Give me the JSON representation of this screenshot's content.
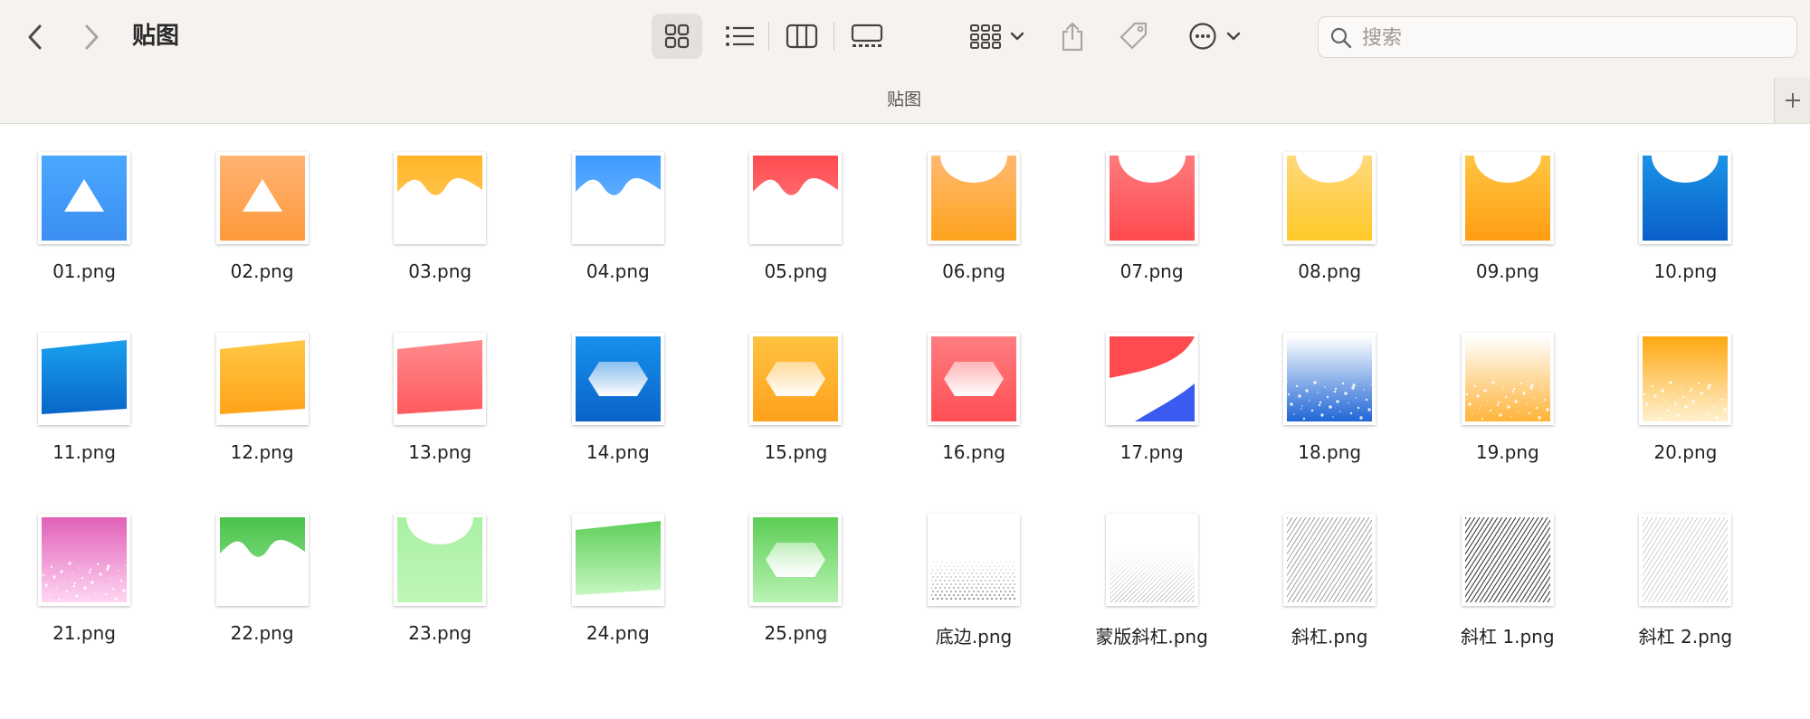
{
  "window": {
    "title": "贴图",
    "tab_title": "贴图"
  },
  "toolbar": {
    "back_icon": "chevron-left-icon",
    "forward_icon": "chevron-right-icon",
    "view_modes": [
      "icon-view",
      "list-view",
      "column-view",
      "gallery-view"
    ],
    "active_view": "icon-view"
  },
  "search": {
    "placeholder": "搜索",
    "value": ""
  },
  "files": [
    {
      "name": "01.png",
      "art": "tri",
      "c1": "#4aa8ff",
      "c2": "#3b8ef0"
    },
    {
      "name": "02.png",
      "art": "tri",
      "c1": "#ffb374",
      "c2": "#ff9a3c"
    },
    {
      "name": "03.png",
      "art": "wave",
      "c1": "#ffb428",
      "c2": "#ffd26a"
    },
    {
      "name": "04.png",
      "art": "wave",
      "c1": "#3d9bff",
      "c2": "#7fbeff"
    },
    {
      "name": "05.png",
      "art": "wave",
      "c1": "#ff4a4f",
      "c2": "#ff8a8c"
    },
    {
      "name": "06.png",
      "art": "arc",
      "c1": "#ffb870",
      "c2": "#ffa41f"
    },
    {
      "name": "07.png",
      "art": "arc",
      "c1": "#ff7a7c",
      "c2": "#ff4b50"
    },
    {
      "name": "08.png",
      "art": "arc",
      "c1": "#ffd87d",
      "c2": "#ffc928"
    },
    {
      "name": "09.png",
      "art": "arc",
      "c1": "#ffc542",
      "c2": "#ff9e14"
    },
    {
      "name": "10.png",
      "art": "arc",
      "c1": "#1a94e6",
      "c2": "#0a5fc9"
    },
    {
      "name": "11.png",
      "art": "slant",
      "c1": "#1aa0ee",
      "c2": "#0866c8"
    },
    {
      "name": "12.png",
      "art": "slant",
      "c1": "#ffc845",
      "c2": "#ffa31a"
    },
    {
      "name": "13.png",
      "art": "slant",
      "c1": "#ff8a8c",
      "c2": "#ff5a5e"
    },
    {
      "name": "14.png",
      "art": "hex",
      "c1": "#1791ee",
      "c2": "#0a63c6"
    },
    {
      "name": "15.png",
      "art": "hex",
      "c1": "#ffc341",
      "c2": "#ffa11c"
    },
    {
      "name": "16.png",
      "art": "hex",
      "c1": "#ff7d80",
      "c2": "#ff4f55"
    },
    {
      "name": "17.png",
      "art": "pepsi",
      "c1": "#ff4b50",
      "c2": "#3b5bf0"
    },
    {
      "name": "18.png",
      "art": "sparkle",
      "c1": "#ffffff",
      "c2": "#1f66d6"
    },
    {
      "name": "19.png",
      "art": "sparkle",
      "c1": "#ffffff",
      "c2": "#ffb43a"
    },
    {
      "name": "20.png",
      "art": "sparkle",
      "c1": "#ffa812",
      "c2": "#fff1cf"
    },
    {
      "name": "21.png",
      "art": "sparkle",
      "c1": "#e060b8",
      "c2": "#ffd6f2"
    },
    {
      "name": "22.png",
      "art": "wave",
      "c1": "#49c24a",
      "c2": "#9de89a"
    },
    {
      "name": "23.png",
      "art": "arc",
      "c1": "#a9f0a4",
      "c2": "#bff7b7"
    },
    {
      "name": "24.png",
      "art": "slant",
      "c1": "#5fd05a",
      "c2": "#c6f7c1"
    },
    {
      "name": "25.png",
      "art": "hex",
      "c1": "#5ccd54",
      "c2": "#b9f3b3"
    },
    {
      "name": "底边.png",
      "art": "dots",
      "c1": "#ffffff",
      "c2": "#8a8a8a"
    },
    {
      "name": "蒙版斜杠.png",
      "art": "fadehatch",
      "c1": "#ffffff",
      "c2": "#9a9a9a"
    },
    {
      "name": "斜杠.png",
      "art": "hatch",
      "c1": "#ffffff",
      "c2": "#8c8c8c"
    },
    {
      "name": "斜杠 1.png",
      "art": "hatchdark",
      "c1": "#ffffff",
      "c2": "#3d3d3d"
    },
    {
      "name": "斜杠 2.png",
      "art": "hatchlight",
      "c1": "#ffffff",
      "c2": "#b5b5b5"
    }
  ]
}
